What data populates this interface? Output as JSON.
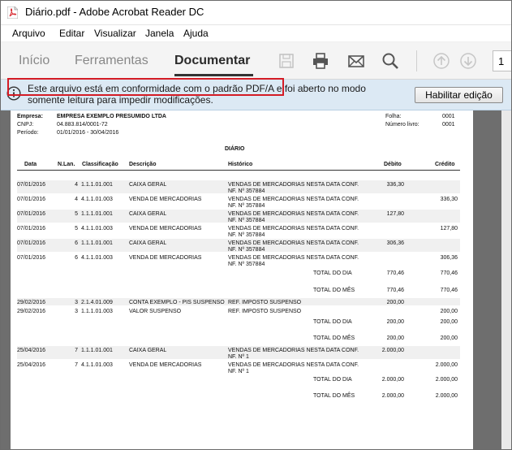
{
  "window": {
    "title": "Diário.pdf - Adobe Acrobat Reader DC",
    "app_icon": "acrobat-pdf-icon"
  },
  "menu": [
    "Arquivo",
    "Editar",
    "Visualizar",
    "Janela",
    "Ajuda"
  ],
  "tabs": [
    {
      "label": "Início",
      "active": false
    },
    {
      "label": "Ferramentas",
      "active": false
    },
    {
      "label": "Documentar",
      "active": true
    }
  ],
  "toolbar": {
    "icons": [
      "save-icon",
      "print-icon",
      "email-icon",
      "search-icon",
      "page-up-icon",
      "page-down-icon"
    ],
    "page_number": "1"
  },
  "notice": {
    "text": "Este arquivo está em conformidade com o padrão PDF/A e foi aberto no modo somente leitura para impedir modificações.",
    "button": "Habilitar edição",
    "highlight_color": "#d41c25"
  },
  "document": {
    "header": {
      "empresa_label": "Empresa:",
      "empresa": "EMPRESA EXEMPLO PRESUMIDO LTDA",
      "cnpj_label": "CNPJ:",
      "cnpj": "04.883.814/0001-72",
      "periodo_label": "Período:",
      "periodo": "01/01/2016 - 30/04/2016",
      "folha_label": "Folha:",
      "folha": "0001",
      "livro_label": "Número livro:",
      "livro": "0001"
    },
    "title": "DIÁRIO",
    "columns": [
      "Data",
      "N.Lan.",
      "Classificação",
      "Descrição",
      "Histórico",
      "Débito",
      "Crédito"
    ],
    "rows": [
      {
        "data": "07/01/2016",
        "nlan": "4",
        "classificacao": "1.1.1.01.001",
        "descricao": "CAIXA GERAL",
        "historico": [
          "VENDAS DE MERCADORIAS NESTA DATA CONF.",
          "NF. Nº 357884"
        ],
        "debito": "336,30",
        "credito": ""
      },
      {
        "data": "07/01/2016",
        "nlan": "4",
        "classificacao": "4.1.1.01.003",
        "descricao": "VENDA DE MERCADORIAS",
        "historico": [
          "VENDAS DE MERCADORIAS NESTA DATA CONF.",
          "NF. Nº 357884"
        ],
        "debito": "",
        "credito": "336,30"
      },
      {
        "data": "07/01/2016",
        "nlan": "5",
        "classificacao": "1.1.1.01.001",
        "descricao": "CAIXA GERAL",
        "historico": [
          "VENDAS DE MERCADORIAS NESTA DATA CONF.",
          "NF. Nº 357884"
        ],
        "debito": "127,80",
        "credito": ""
      },
      {
        "data": "07/01/2016",
        "nlan": "5",
        "classificacao": "4.1.1.01.003",
        "descricao": "VENDA DE MERCADORIAS",
        "historico": [
          "VENDAS DE MERCADORIAS NESTA DATA CONF.",
          "NF. Nº 357884"
        ],
        "debito": "",
        "credito": "127,80"
      },
      {
        "data": "07/01/2016",
        "nlan": "6",
        "classificacao": "1.1.1.01.001",
        "descricao": "CAIXA GERAL",
        "historico": [
          "VENDAS DE MERCADORIAS NESTA DATA CONF.",
          "NF. Nº 357884"
        ],
        "debito": "306,36",
        "credito": ""
      },
      {
        "data": "07/01/2016",
        "nlan": "6",
        "classificacao": "4.1.1.01.003",
        "descricao": "VENDA DE MERCADORIAS",
        "historico": [
          "VENDAS DE MERCADORIAS NESTA DATA CONF.",
          "NF. Nº 357884"
        ],
        "debito": "",
        "credito": "306,36"
      }
    ],
    "totals1": [
      {
        "label": "TOTAL DO DIA",
        "debito": "770,46",
        "credito": "770,46"
      },
      {
        "label": "TOTAL DO MÊS",
        "debito": "770,46",
        "credito": "770,46"
      }
    ],
    "rows2": [
      {
        "data": "29/02/2016",
        "nlan": "3",
        "classificacao": "2.1.4.01.009",
        "descricao": "CONTA EXEMPLO - PIS SUSPENSO",
        "historico": [
          "REF. IMPOSTO SUSPENSO"
        ],
        "debito": "200,00",
        "credito": ""
      },
      {
        "data": "29/02/2016",
        "nlan": "3",
        "classificacao": "1.1.1.01.003",
        "descricao": "VALOR SUSPENSO",
        "historico": [
          "REF. IMPOSTO SUSPENSO"
        ],
        "debito": "",
        "credito": "200,00"
      }
    ],
    "totals2": [
      {
        "label": "TOTAL DO DIA",
        "debito": "200,00",
        "credito": "200,00"
      },
      {
        "label": "TOTAL DO MÊS",
        "debito": "200,00",
        "credito": "200,00"
      }
    ],
    "rows3": [
      {
        "data": "25/04/2016",
        "nlan": "7",
        "classificacao": "1.1.1.01.001",
        "descricao": "CAIXA GERAL",
        "historico": [
          "VENDAS DE MERCADORIAS NESTA DATA CONF.",
          "NF. Nº 1"
        ],
        "debito": "2.000,00",
        "credito": ""
      },
      {
        "data": "25/04/2016",
        "nlan": "7",
        "classificacao": "4.1.1.01.003",
        "descricao": "VENDA DE MERCADORIAS",
        "historico": [
          "VENDAS DE MERCADORIAS NESTA DATA CONF.",
          "NF. Nº 1"
        ],
        "debito": "",
        "credito": "2.000,00"
      }
    ],
    "totals3": [
      {
        "label": "TOTAL DO DIA",
        "debito": "2.000,00",
        "credito": "2.000,00"
      },
      {
        "label": "TOTAL DO MÊS",
        "debito": "2.000,00",
        "credito": "2.000,00"
      }
    ]
  }
}
